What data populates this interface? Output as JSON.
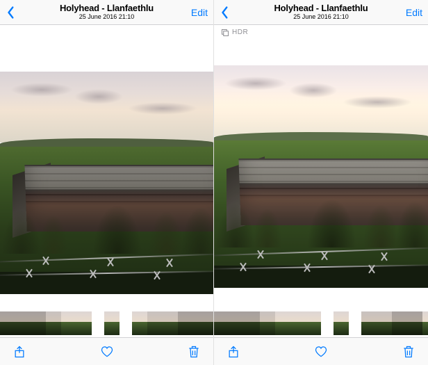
{
  "panes": [
    {
      "title": "Holyhead - Llanfaethlu",
      "subtitle": "25 June 2016  21:10",
      "edit_label": "Edit",
      "hdr_label": "",
      "show_hdr": false
    },
    {
      "title": "Holyhead - Llanfaethlu",
      "subtitle": "25 June 2016  21:10",
      "edit_label": "Edit",
      "hdr_label": "HDR",
      "show_hdr": true
    }
  ],
  "icons": {
    "back": "chevron-left",
    "share": "share",
    "favorite": "heart",
    "delete": "trash",
    "hdr_stack": "rectangle-stack"
  },
  "colors": {
    "tint": "#007aff",
    "separator": "#d1d1d4",
    "bar_bg": "#f9f9f9",
    "secondary_text": "#8e8e93"
  }
}
